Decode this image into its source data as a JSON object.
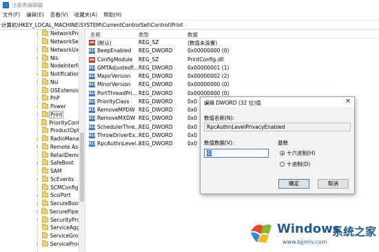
{
  "window": {
    "title": "注册表编辑器"
  },
  "menu": [
    "文件(F)",
    "编辑(E)",
    "查看(V)",
    "收藏夹(A)",
    "帮助(H)"
  ],
  "address": "计算机\\HKEY_LOCAL_MACHINE\\SYSTEM\\CurrentControlSet\\Control\\Print",
  "tree": {
    "items": [
      {
        "label": "NetworkProv",
        "expander": "›"
      },
      {
        "label": "NetworkSetu",
        "expander": ""
      },
      {
        "label": "NetworkUxM",
        "expander": "›"
      },
      {
        "label": "Nls",
        "expander": "›"
      },
      {
        "label": "NodeInterfac",
        "expander": ""
      },
      {
        "label": "Notifications",
        "expander": "›"
      },
      {
        "label": "Nsi",
        "expander": "›"
      },
      {
        "label": "OSExtensionI",
        "expander": ""
      },
      {
        "label": "PnP",
        "expander": "›"
      },
      {
        "label": "Power",
        "expander": "›"
      },
      {
        "label": "Print",
        "expander": "›",
        "selected": true
      },
      {
        "label": "PriorityContro",
        "expander": ""
      },
      {
        "label": "ProductOptic",
        "expander": ""
      },
      {
        "label": "RadioManag",
        "expander": "›"
      },
      {
        "label": "Remote Assis",
        "expander": "›"
      },
      {
        "label": "RetailDemo",
        "expander": ""
      },
      {
        "label": "SafeBoot",
        "expander": "›"
      },
      {
        "label": "SAM",
        "expander": ""
      },
      {
        "label": "ScEvents",
        "expander": "›"
      },
      {
        "label": "SCMConfig",
        "expander": ""
      },
      {
        "label": "ScsiPort",
        "expander": "›"
      },
      {
        "label": "SecureBoot",
        "expander": "›"
      },
      {
        "label": "SecurePipeSe",
        "expander": "›"
      },
      {
        "label": "SecurityProvi",
        "expander": "›"
      },
      {
        "label": "ServiceAggre",
        "expander": ""
      },
      {
        "label": "ServiceGroup",
        "expander": ""
      },
      {
        "label": "ServiceProvic",
        "expander": "›"
      }
    ]
  },
  "list": {
    "headers": {
      "name": "名称",
      "type": "类型",
      "data": "数据"
    },
    "rows": [
      {
        "icon": "ab",
        "icon_type": "sz",
        "name": "(默认)",
        "type": "REG_SZ",
        "data": "(数值未设置)"
      },
      {
        "icon": "011",
        "icon_type": "dw",
        "name": "BeepEnabled",
        "type": "REG_DWORD",
        "data": "0x00000000 (0)"
      },
      {
        "icon": "ab",
        "icon_type": "sz",
        "name": "ConfigModule",
        "type": "REG_SZ",
        "data": "PrintConfig.dll"
      },
      {
        "icon": "011",
        "icon_type": "dw",
        "name": "GMTAdjustedF...",
        "type": "REG_DWORD",
        "data": "0x00000001 (1)"
      },
      {
        "icon": "011",
        "icon_type": "dw",
        "name": "MajorVersion",
        "type": "REG_DWORD",
        "data": "0x00000002 (2)"
      },
      {
        "icon": "011",
        "icon_type": "dw",
        "name": "MinorVersion",
        "type": "REG_DWORD",
        "data": "0x00000000 (0)"
      },
      {
        "icon": "011",
        "icon_type": "dw",
        "name": "PortThreadPri...",
        "type": "REG_DWORD",
        "data": "0x00000000 (0)"
      },
      {
        "icon": "011",
        "icon_type": "dw",
        "name": "PriorityClass",
        "type": "REG_DWORD",
        "data": "0x0"
      },
      {
        "icon": "011",
        "icon_type": "dw",
        "name": "RemoveMPDW",
        "type": "REG_DWORD",
        "data": "0x0"
      },
      {
        "icon": "011",
        "icon_type": "dw",
        "name": "RemoveMXDW",
        "type": "REG_DWORD",
        "data": "0x0"
      },
      {
        "icon": "011",
        "icon_type": "dw",
        "name": "SchedulerThre...",
        "type": "REG_DWORD",
        "data": "0x0"
      },
      {
        "icon": "011",
        "icon_type": "dw",
        "name": "ThrowDriverEx...",
        "type": "REG_DWORD",
        "data": "0x0"
      },
      {
        "icon": "011",
        "icon_type": "dw",
        "name": "RpcAuthnLevel...",
        "type": "REG_DWORD",
        "data": "0x0"
      }
    ]
  },
  "dialog": {
    "title": "编辑 DWORD (32 位)值",
    "close": "✕",
    "name_label": "数值名称(N):",
    "name_value": "RpcAuthnLevelPrivacyEnabled",
    "data_label": "数值数据(V):",
    "data_value": "0",
    "base_label": "基数",
    "hex_label": "十六进制(H)",
    "dec_label": "十进制(D)",
    "base_selected": "hex",
    "ok": "确定",
    "cancel": "取消"
  },
  "watermark": {
    "brand": "Windows",
    "cn": "系统之家",
    "url": "www.bjjmlv.com"
  }
}
